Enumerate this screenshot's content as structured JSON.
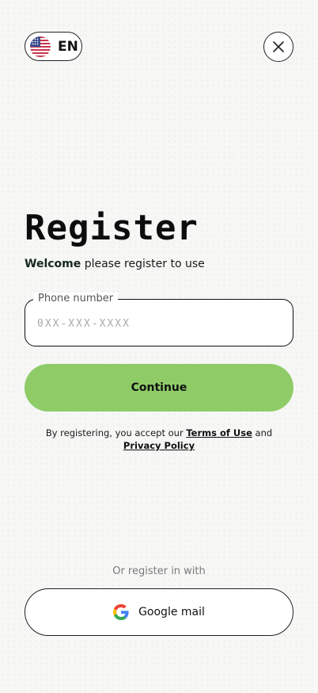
{
  "language": {
    "code": "EN",
    "flag_icon": "us-flag-icon"
  },
  "close_icon": "close-icon",
  "title": "Register",
  "subtitle": {
    "bold": "Welcome",
    "rest": " please register to use"
  },
  "phone_field": {
    "label": "Phone number",
    "placeholder": "0XX-XXX-XXXX",
    "value": ""
  },
  "continue_button": {
    "label": "Continue",
    "color": "#8fcc68"
  },
  "terms": {
    "prefix": "By registering, you accept our ",
    "terms_link": "Terms of Use",
    "middle": " and",
    "privacy_link": "Privacy Policy"
  },
  "alt_register": {
    "text": "Or register in with",
    "google_label": "Google mail",
    "google_icon": "google-icon"
  }
}
